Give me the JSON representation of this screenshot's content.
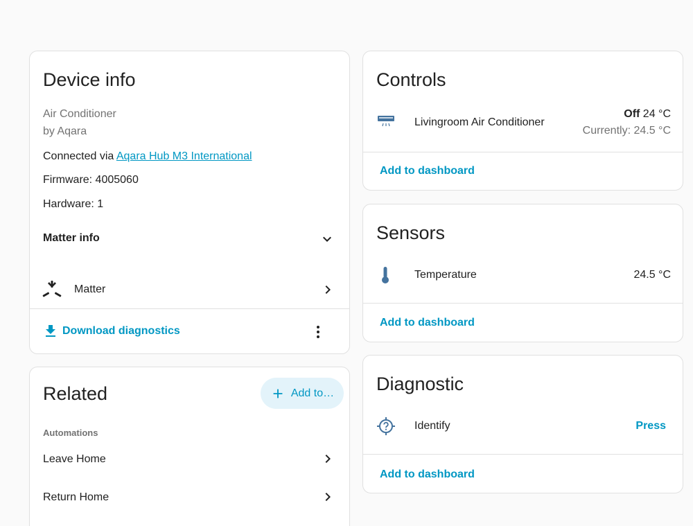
{
  "device_info": {
    "title": "Device info",
    "model": "Air Conditioner",
    "manufacturer": "by Aqara",
    "connected_via_prefix": "Connected via ",
    "connected_via_link": "Aqara Hub M3 International",
    "firmware": "Firmware: 4005060",
    "hardware": "Hardware: 1",
    "matter_info_label": "Matter info",
    "integration_label": "Matter",
    "download_label": "Download diagnostics"
  },
  "related": {
    "title": "Related",
    "add_to_label": "Add to…",
    "section_label": "Automations",
    "items": [
      {
        "label": "Leave Home"
      },
      {
        "label": "Return Home"
      }
    ]
  },
  "controls": {
    "title": "Controls",
    "entity_name": "Livingroom Air Conditioner",
    "state_bold": "Off",
    "state_target": " 24 °C",
    "current": "Currently: 24.5 °C",
    "add_to_dashboard": "Add to dashboard"
  },
  "sensors": {
    "title": "Sensors",
    "entity_name": "Temperature",
    "value": "24.5 °C",
    "add_to_dashboard": "Add to dashboard"
  },
  "diagnostic": {
    "title": "Diagnostic",
    "entity_name": "Identify",
    "action_label": "Press",
    "add_to_dashboard": "Add to dashboard"
  },
  "icons": {
    "air_conditioner": "air-conditioner-icon",
    "thermometer": "thermometer-icon",
    "identify": "crosshairs-question-icon",
    "matter": "matter-logo-icon",
    "download": "download-icon",
    "more": "dots-vertical-icon",
    "chevron_down": "chevron-down-icon",
    "chevron_right": "chevron-right-icon",
    "plus": "plus-icon"
  },
  "colors": {
    "accent": "#0097c3",
    "icon": "#44739e",
    "text_primary": "#212121",
    "text_secondary": "#727272",
    "background": "#fafafa"
  }
}
